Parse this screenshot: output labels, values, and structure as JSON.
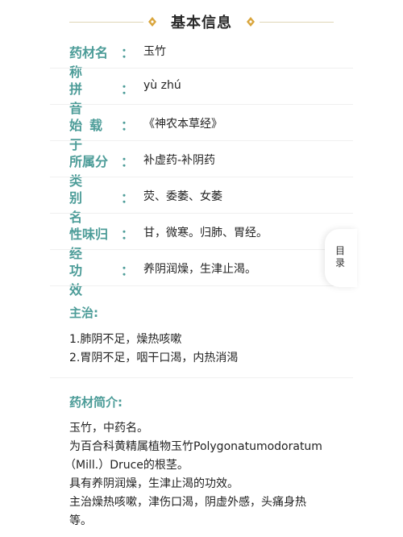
{
  "header": {
    "title": "基本信息",
    "accent_color": "#d9a53c",
    "line_color": "#dfd6b6"
  },
  "info_rows": [
    {
      "label": "药材名称",
      "colon": "：",
      "value": "玉竹"
    },
    {
      "label": "拼音",
      "colon": "：",
      "value": "yù zhú"
    },
    {
      "label": "始载于",
      "colon": "：",
      "value": "《神农本草经》"
    },
    {
      "label": "所属分类",
      "colon": "：",
      "value": "补虚药-补阴药"
    },
    {
      "label": "别名",
      "colon": "：",
      "value": "荧、委萎、女萎"
    },
    {
      "label": "性味归经",
      "colon": "：",
      "value": "甘，微寒。归肺、胃经。"
    },
    {
      "label": "功效",
      "colon": "：",
      "value": "养阴润燥，生津止渴。"
    }
  ],
  "indications": {
    "title": "主治:",
    "items": [
      "1.肺阴不足，燥热咳嗽",
      "2.胃阴不足，咽干口渴，内热消渴"
    ]
  },
  "intro": {
    "title": "药材简介:",
    "lines": [
      "玉竹，中药名。",
      "为百合科黄精属植物玉竹Polygonatumodoratum",
      "（Mill.）Druce的根茎。",
      "具有养阴润燥，生津止渴的功效。",
      "主治燥热咳嗽，津伤口渴，阴虚外感，头痛身热",
      "等。"
    ]
  },
  "toc_tab": {
    "label": "目录"
  },
  "label_color": "#4c9c98"
}
